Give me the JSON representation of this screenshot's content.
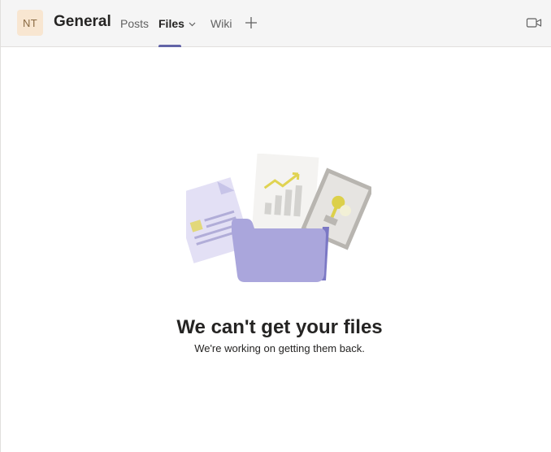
{
  "header": {
    "avatar_initials": "NT",
    "channel_name": "General",
    "tabs": [
      {
        "label": "Posts",
        "active": false
      },
      {
        "label": "Files",
        "active": true
      },
      {
        "label": "Wiki",
        "active": false
      }
    ],
    "accent_color": "#6264a7",
    "icons": {
      "files_dropdown": "chevron-down-icon",
      "add_tab": "plus-icon",
      "meet": "video-camera-icon"
    }
  },
  "empty_state": {
    "title": "We can't get your files",
    "subtitle": "We're working on getting them back.",
    "illustration": "files-folder-illustration"
  }
}
